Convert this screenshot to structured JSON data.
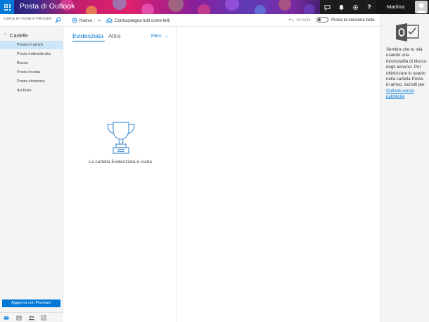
{
  "header": {
    "app_title": "Posta di Outlook",
    "user_name": "Martina",
    "icons": [
      "skype-icon",
      "bell-icon",
      "gear-icon",
      "help-icon"
    ],
    "brand_color": "#0078d7"
  },
  "search": {
    "placeholder": "Cerca in Posta e Persone"
  },
  "toolbar": {
    "new_label": "Nuovo",
    "mark_all_read_label": "Contrassegna tutti come letti",
    "undo_label": "Annulla",
    "beta_label": "Prova la versione beta"
  },
  "sidebar": {
    "folders_header": "Cartelle",
    "items": [
      {
        "label": "Posta in arrivo",
        "active": true
      },
      {
        "label": "Posta indesiderata",
        "active": false
      },
      {
        "label": "Bozze",
        "active": false
      },
      {
        "label": "Posta inviata",
        "active": false
      },
      {
        "label": "Posta eliminata",
        "active": false
      },
      {
        "label": "Archivio",
        "active": false
      }
    ],
    "premium_button": "Aggiorna con Premium",
    "bottom_icons": [
      "mail-icon",
      "calendar-icon",
      "people-icon",
      "tasks-icon"
    ]
  },
  "message_list": {
    "tabs": [
      {
        "label": "Evidenziata",
        "selected": true
      },
      {
        "label": "Altra",
        "selected": false
      }
    ],
    "filter_label": "Filtro",
    "empty_message": "La cartella Evidenziata è vuota"
  },
  "ad": {
    "text": "Sembra che tu stia usando una funzionalità di blocco degli annunci. Per ottimizzare lo spazio nella cartella Posta in arrivo, iscriviti per",
    "link_text": "Outlook senza pubblicità"
  }
}
